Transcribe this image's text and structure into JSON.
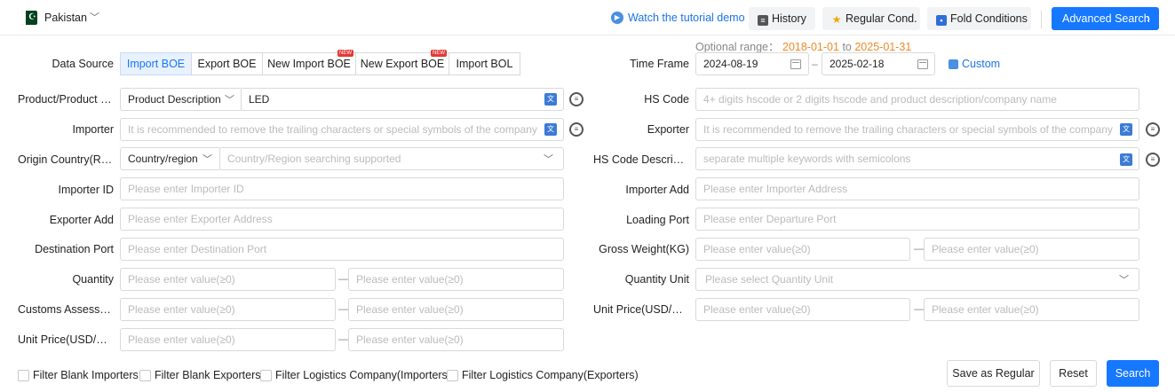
{
  "topbar": {
    "country": "Pakistan",
    "tutorial": "Watch the tutorial demo",
    "history": "History",
    "regular_cond": "Regular Cond.",
    "fold_conditions": "Fold Conditions",
    "advanced_search": "Advanced Search"
  },
  "data_source": {
    "label": "Data Source",
    "tabs": [
      "Import BOE",
      "Export BOE",
      "New Import BOE",
      "New Export BOE",
      "Import BOL"
    ],
    "new_tag": "NEW",
    "active": "Import BOE"
  },
  "time_frame": {
    "range_label": "Optional range：",
    "range_start": "2018-01-01",
    "range_to": "to",
    "range_end": "2025-01-31",
    "label": "Time Frame",
    "start": "2024-08-19",
    "end": "2025-02-18",
    "custom": "Custom"
  },
  "left": {
    "product_label": "Product/Product D...",
    "product_select": "Product Description",
    "product_value": "LED",
    "importer_label": "Importer",
    "importer_placeholder": "It is recommended to remove the trailing characters or special symbols of the company",
    "origin_label": "Origin Country(Regi...",
    "origin_select": "Country/region",
    "origin_placeholder": "Country/Region searching supported",
    "importer_id_label": "Importer ID",
    "importer_id_placeholder": "Please enter Importer ID",
    "exporter_add_label": "Exporter Add",
    "exporter_add_placeholder": "Please enter Exporter Address",
    "dest_port_label": "Destination Port",
    "dest_port_placeholder": "Please enter Destination Port",
    "quantity_label": "Quantity",
    "customs_label": "Customs Assessed...",
    "unit_price_qty_label": "Unit Price(USD/QTY)",
    "value_placeholder": "Please enter value(≥0)"
  },
  "right": {
    "hs_code_label": "HS Code",
    "hs_code_placeholder": "4+ digits hscode or 2 digits hscode and product description/company name",
    "exporter_label": "Exporter",
    "exporter_placeholder": "It is recommended to remove the trailing characters or special symbols of the company",
    "hs_desc_label": "HS Code Descriptio...",
    "hs_desc_placeholder": "separate multiple keywords with semicolons",
    "importer_add_label": "Importer Add",
    "importer_add_placeholder": "Please enter Importer Address",
    "loading_port_label": "Loading Port",
    "loading_port_placeholder": "Please enter Departure Port",
    "gross_weight_label": "Gross Weight(KG)",
    "quantity_unit_label": "Quantity Unit",
    "quantity_unit_placeholder": "Please select Quantity Unit",
    "unit_price_kg_label": "Unit Price(USD/KG)"
  },
  "bottom": {
    "filters": [
      "Filter Blank Importers",
      "Filter Blank Exporters",
      "Filter Logistics Company(Importers)",
      "Filter Logistics Company(Exporters)"
    ],
    "save_regular": "Save as Regular",
    "reset": "Reset",
    "search": "Search"
  },
  "colors": {
    "primary": "#1677ff",
    "range_orange": "#f08a24",
    "link": "#1a73e8"
  }
}
